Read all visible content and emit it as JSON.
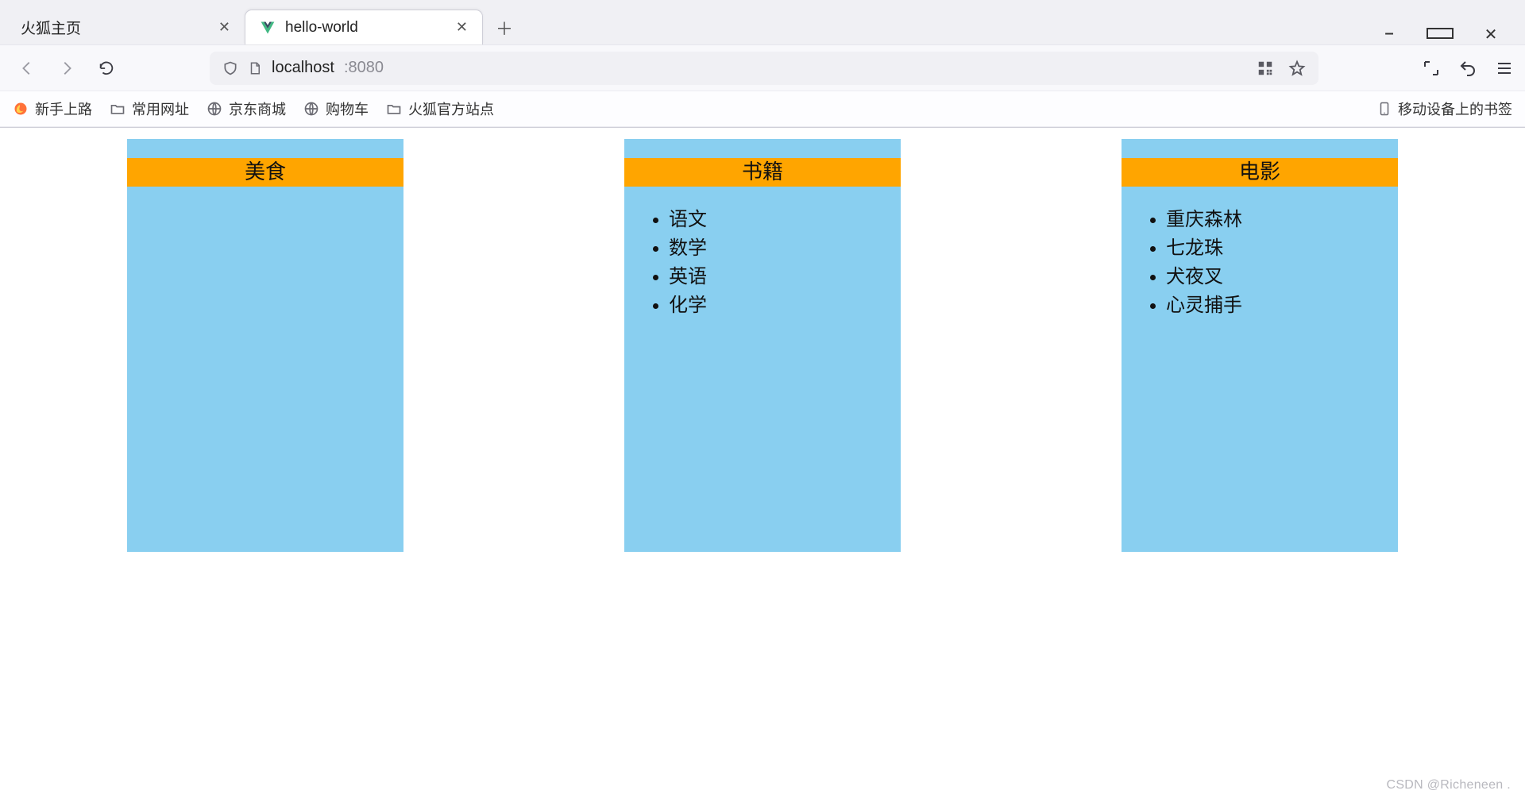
{
  "window_controls": {
    "minimize": "min",
    "maximize": "max",
    "close": "close"
  },
  "tabs": [
    {
      "title": "火狐主页",
      "active": false
    },
    {
      "title": "hello-world",
      "active": true
    }
  ],
  "toolbar": {
    "back": "←",
    "forward": "→",
    "reload": "⟳",
    "shield": "shield",
    "lock": "page",
    "screenshot": "screenshot",
    "undo": "undo",
    "menu": "menu"
  },
  "url": {
    "host": "localhost",
    "port": ":8080"
  },
  "url_icons": {
    "qr": "qr",
    "star": "star"
  },
  "bookmarks": {
    "items": [
      {
        "icon": "firefox",
        "label": "新手上路"
      },
      {
        "icon": "folder",
        "label": "常用网址"
      },
      {
        "icon": "globe",
        "label": "京东商城"
      },
      {
        "icon": "globe",
        "label": "购物车"
      },
      {
        "icon": "folder",
        "label": "火狐官方站点"
      }
    ],
    "right": {
      "icon": "device",
      "label": "移动设备上的书签"
    }
  },
  "content": {
    "cards": [
      {
        "title": "美食",
        "items": []
      },
      {
        "title": "书籍",
        "items": [
          "语文",
          "数学",
          "英语",
          "化学"
        ]
      },
      {
        "title": "电影",
        "items": [
          "重庆森林",
          "七龙珠",
          "犬夜叉",
          "心灵捕手"
        ]
      }
    ]
  },
  "watermark": "CSDN @Richeneen ."
}
